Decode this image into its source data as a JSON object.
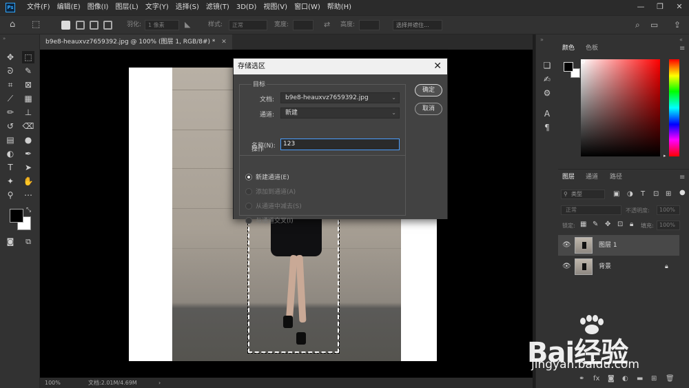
{
  "app": {
    "logo": "Ps"
  },
  "menu": [
    "文件(F)",
    "编辑(E)",
    "图像(I)",
    "图层(L)",
    "文字(Y)",
    "选择(S)",
    "滤镜(T)",
    "3D(D)",
    "视图(V)",
    "窗口(W)",
    "帮助(H)"
  ],
  "options": {
    "feather_label": "羽化:",
    "feather_value": "1 像素",
    "style_label": "样式:",
    "style_value": "正常",
    "width_label": "宽度:",
    "height_label": "高度:",
    "select_mask_button": "选择并遮住..."
  },
  "document": {
    "tab_title": "b9e8-heauxvz7659392.jpg @ 100% (图层 1, RGB/8#) *",
    "zoom": "100%",
    "doc_size": "文档:2.01M/4.69M"
  },
  "dialog": {
    "title": "存储选区",
    "target_group": "目标",
    "document_label": "文档:",
    "document_value": "b9e8-heauxvz7659392.jpg",
    "channel_label": "通道:",
    "channel_value": "新建",
    "name_label": "名称(N):",
    "name_value": "123",
    "operation_group": "操作",
    "ops": [
      {
        "label": "新建通道(E)",
        "selected": true,
        "enabled": true
      },
      {
        "label": "添加到通道(A)",
        "selected": false,
        "enabled": false
      },
      {
        "label": "从通道中减去(S)",
        "selected": false,
        "enabled": false
      },
      {
        "label": "与通道交叉(I)",
        "selected": false,
        "enabled": false
      }
    ],
    "ok_button": "确定",
    "cancel_button": "取消"
  },
  "panels": {
    "color_tabs": [
      "颜色",
      "色板"
    ],
    "layer_tabs": [
      "图层",
      "通道",
      "路径"
    ],
    "filter_label": "类型",
    "blend_mode": "正常",
    "opacity_label": "不透明度:",
    "opacity_value": "100%",
    "lock_label": "锁定:",
    "fill_label": "填充:",
    "fill_value": "100%",
    "layers": [
      {
        "name": "图层 1",
        "selected": true,
        "locked": false
      },
      {
        "name": "背景",
        "selected": false,
        "locked": true
      }
    ]
  },
  "watermark": {
    "brand": "Bai经验",
    "url": "jingyan.baidu.com"
  },
  "colors": {
    "accent": "#4a9eff",
    "photoshop_blue": "#31a8ff"
  }
}
